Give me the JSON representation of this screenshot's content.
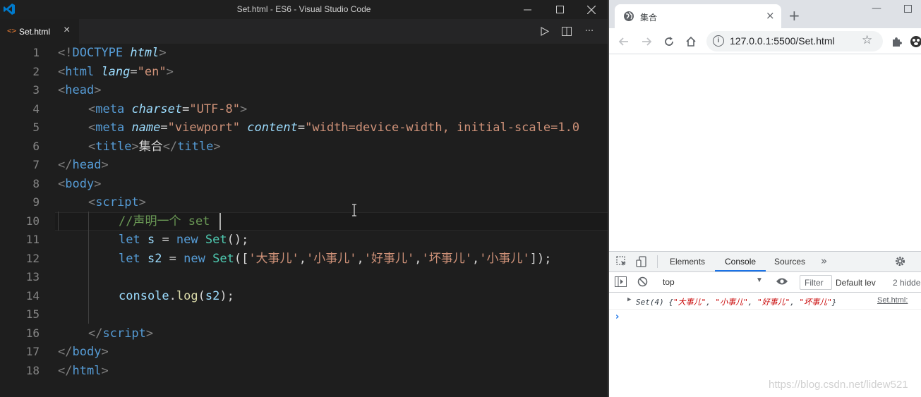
{
  "vscode": {
    "window_title": "Set.html - ES6 - Visual Studio Code",
    "colors": {
      "accent": "#007acc",
      "tab_icon": "#e37933"
    },
    "tab": {
      "label": "Set.html"
    },
    "line_numbers": [
      "1",
      "2",
      "3",
      "4",
      "5",
      "6",
      "7",
      "8",
      "9",
      "10",
      "11",
      "12",
      "13",
      "14",
      "15",
      "16",
      "17",
      "18"
    ],
    "code": {
      "l1": {
        "lt": "<!",
        "tag": "DOCTYPE",
        "attr": " html",
        "gt": ">"
      },
      "l2": {
        "lt": "<",
        "tag": "html",
        "attr": " lang",
        "eq": "=",
        "val": "\"en\"",
        "gt": ">"
      },
      "l3": {
        "lt": "<",
        "tag": "head",
        "gt": ">"
      },
      "l4": {
        "lt": "<",
        "tag": "meta",
        "attr": " charset",
        "eq": "=",
        "val": "\"UTF-8\"",
        "gt": ">"
      },
      "l5": {
        "lt": "<",
        "tag": "meta",
        "attr": " name",
        "eq": "=",
        "val": "\"viewport\"",
        "attr2": " content",
        "eq2": "=",
        "val2": "\"width=device-width, initial-scale=1.0"
      },
      "l6": {
        "lt": "<",
        "tag": "title",
        "gt": ">",
        "text": "集合",
        "lt2": "</",
        "tag2": "title",
        "gt2": ">"
      },
      "l7": {
        "lt": "</",
        "tag": "head",
        "gt": ">"
      },
      "l8": {
        "lt": "<",
        "tag": "body",
        "gt": ">"
      },
      "l9": {
        "lt": "<",
        "tag": "script",
        "gt": ">"
      },
      "l10": {
        "comment": "//声明一个 set"
      },
      "l11": {
        "kw": "let",
        "var": " s",
        "op": " = ",
        "kw2": "new",
        "cls": " Set",
        "rest": "();"
      },
      "l12": {
        "kw": "let",
        "var": " s2",
        "op": " = ",
        "kw2": "new",
        "cls": " Set",
        "p1": "([",
        "s1": "'大事儿'",
        "c1": ",",
        "s2": "'小事儿'",
        "c2": ",",
        "s3": "'好事儿'",
        "c3": ",",
        "s4": "'坏事儿'",
        "c4": ",",
        "s5": "'小事儿'",
        "p2": "]);"
      },
      "l14": {
        "obj": "console",
        "dot": ".",
        "fn": "log",
        "p1": "(",
        "arg": "s2",
        "p2": ");"
      },
      "l16": {
        "lt": "</",
        "tag": "script",
        "gt": ">"
      },
      "l17": {
        "lt": "</",
        "tag": "body",
        "gt": ">"
      },
      "l18": {
        "lt": "</",
        "tag": "html",
        "gt": ">"
      }
    }
  },
  "browser": {
    "tab_title": "集合",
    "url": "127.0.0.1:5500/Set.html",
    "devtools": {
      "tabs": [
        "Elements",
        "Console",
        "Sources"
      ],
      "active_tab": "Console",
      "context": "top",
      "filter_placeholder": "Filter",
      "levels": "Default lev",
      "hidden": "2 hidde",
      "log_prefix": "Set(4) ",
      "log_open": "{",
      "log_items": [
        "\"大事儿\"",
        "\"小事儿\"",
        "\"好事儿\"",
        "\"坏事儿\""
      ],
      "log_sep": ", ",
      "log_close": "}",
      "log_source": "Set.html:",
      "prompt": "›"
    },
    "watermark": "https://blog.csdn.net/lidew521"
  }
}
